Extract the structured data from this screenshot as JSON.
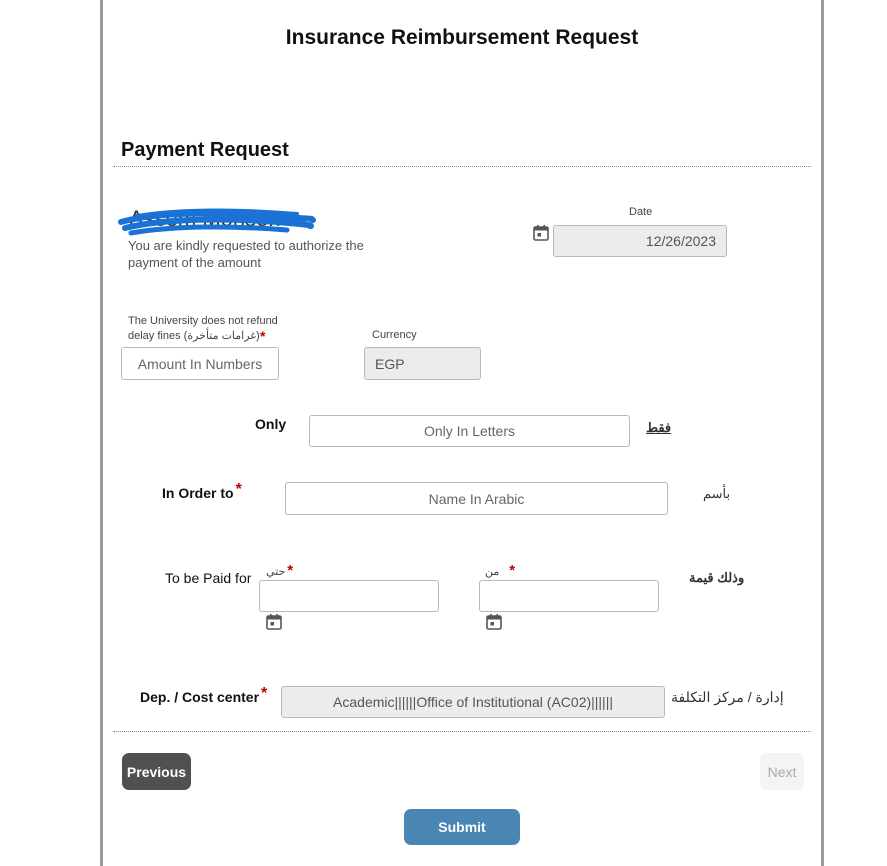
{
  "form": {
    "title": "Insurance Reimbursement Request",
    "section_title": "Payment Request"
  },
  "recipient": {
    "name": "Assem Mohsen .",
    "request_text": "You are kindly requested to authorize the payment of the amount"
  },
  "date": {
    "label": "Date",
    "value": "12/26/2023"
  },
  "amount": {
    "note": "The University does not refund delay fines (غرامات متأخرة)",
    "required_mark": "*",
    "placeholder": "Amount In Numbers"
  },
  "currency": {
    "label": "Currency",
    "value": "EGP"
  },
  "only": {
    "label": "Only",
    "placeholder": "Only In Letters",
    "arabic_label": "فقط"
  },
  "order": {
    "label": "In Order to",
    "required_mark": "*",
    "placeholder": "Name In Arabic",
    "arabic_label": "بأسم"
  },
  "period": {
    "label": "To be Paid for",
    "to_label": "حتي",
    "from_label": "من",
    "required_mark": "*",
    "arabic_label": "وذلك قيمة"
  },
  "cost_center": {
    "label": "Dep. / Cost center",
    "required_mark": "*",
    "value": "Academic||||||Office of Institutional (AC02)||||||",
    "arabic_label": "إدارة / مركز التكلفة"
  },
  "nav": {
    "previous": "Previous",
    "next": "Next",
    "submit": "Submit"
  },
  "colors": {
    "submit": "#4a86b4",
    "previous": "#505050",
    "required": "#bb0000",
    "scribble": "#1a73d4"
  }
}
